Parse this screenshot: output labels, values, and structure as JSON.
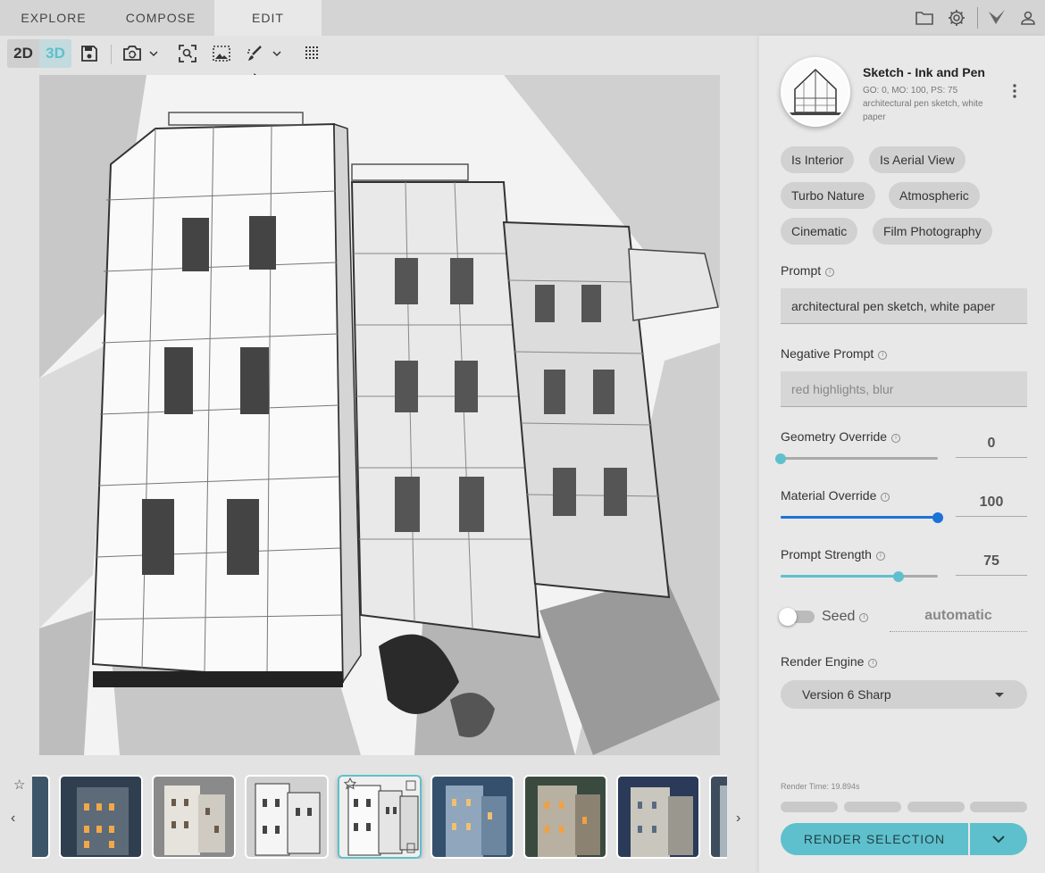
{
  "nav": {
    "tabs": [
      {
        "label": "EXPLORE"
      },
      {
        "label": "COMPOSE"
      },
      {
        "label": "EDIT"
      }
    ],
    "active_tab": "EDIT"
  },
  "toolbar": {
    "mode_2d": "2D",
    "mode_3d": "3D",
    "active_mode": "3D"
  },
  "style": {
    "title": "Sketch - Ink and Pen",
    "meta": "GO: 0, MO: 100, PS: 75",
    "description": "architectural pen sketch, white paper"
  },
  "tags": [
    "Is Interior",
    "Is Aerial View",
    "Turbo Nature",
    "Atmospheric",
    "Cinematic",
    "Film Photography"
  ],
  "prompt": {
    "label": "Prompt",
    "value": "architectural pen sketch, white paper"
  },
  "negative_prompt": {
    "label": "Negative Prompt",
    "placeholder": "red highlights, blur"
  },
  "geometry_override": {
    "label": "Geometry Override",
    "value": "0",
    "fraction": 0
  },
  "material_override": {
    "label": "Material Override",
    "value": "100",
    "fraction": 1
  },
  "prompt_strength": {
    "label": "Prompt Strength",
    "value": "75",
    "fraction": 0.75
  },
  "seed": {
    "label": "Seed",
    "value": "automatic",
    "enabled": false
  },
  "render_engine": {
    "label": "Render Engine",
    "value": "Version 6 Sharp"
  },
  "render_time": "Render Time: 19.894s",
  "render_button": "RENDER SELECTION",
  "colors": {
    "accent": "#5ec0cc",
    "blue": "#1a73d6",
    "topbar": "#d4d4d4",
    "panel": "#e8e8e8"
  }
}
